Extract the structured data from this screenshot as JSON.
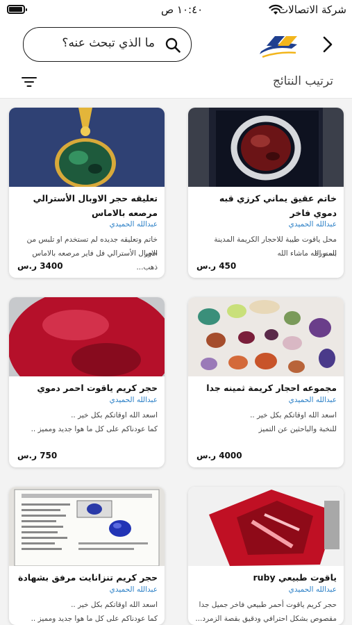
{
  "status_bar": {
    "carrier": "شركة الاتصالات",
    "time": "١٠:٤٠ ص"
  },
  "header": {
    "search_placeholder": "ما الذي تبحث عنه؟",
    "sort_label": "ترتيب النتائج"
  },
  "products": [
    {
      "title": "خاتم عقيق يماني كرزي قبه دموي فاخر",
      "seller": "عبدالله الحميدي",
      "desc1": "محل ياقوت طيبة للاحجار الكريمة المدينة المنورة",
      "desc2": "بسم الله ماشاء الله",
      "price": "450 ر.س"
    },
    {
      "title": "تعليقه حجر الاوبال الأسترالي مرصعه بالاماس",
      "seller": "عبدالله الحميدي",
      "desc1": "خاتم وتعليقه جديده لم تستخدم او تلبس من حجر",
      "desc2": "الاوبال الأسترالي فل فاير مرصعه بالاماس ذهب...",
      "price": "3400 ر.س"
    },
    {
      "title": "مجموعه احجار كريمة ثمينه جدا",
      "seller": "عبدالله الحميدي",
      "desc1": "اسعد الله اوقاتكم بكل خير ..",
      "desc2": "للنخبة والباحثين عن التميز",
      "price": "4000 ر.س"
    },
    {
      "title": "حجر كريم ياقوت احمر دموي",
      "seller": "عبدالله الحميدي",
      "desc1": "اسعد الله اوقاتكم بكل خير ..",
      "desc2": "كما عودناكم على كل ما هوا جديد ومميز ..",
      "price": "750 ر.س"
    },
    {
      "title": "ياقوت طبيعي ruby",
      "seller": "عبدالله الحميدي",
      "desc1": "حجر كريم ياقوت أحمر طبيعي فاخر جميل جدا",
      "desc2": "مقصوص بشكل احترافي ودقيق بقصة الزمرد...",
      "price": ""
    },
    {
      "title": "حجر كريم تنزانايت مرفق بشهادة",
      "seller": "عبدالله الحميدي",
      "desc1": "اسعد الله اوقاتكم بكل خير ..",
      "desc2": "كما عودناكم على كل ما هوا جديد ومميز ..",
      "price": ""
    }
  ],
  "colors": {
    "seller_link": "#2a7fc6",
    "logo_blue": "#1f3f8f",
    "logo_yellow": "#f2b51c"
  }
}
